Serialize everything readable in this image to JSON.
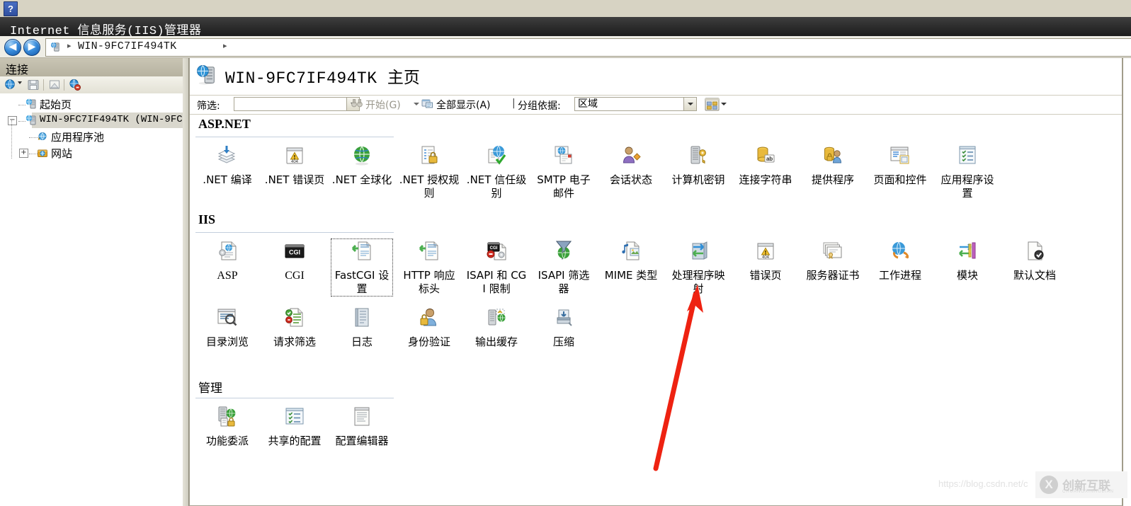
{
  "window": {
    "title": "Internet 信息服务(IIS)管理器",
    "help_icon": "?"
  },
  "address_bar": {
    "back_label": "◀",
    "forward_label": "▶",
    "server_icon": "server-icon",
    "breadcrumb": "WIN-9FC7IF494TK",
    "separator": "▸"
  },
  "connections": {
    "header": "连接",
    "toolbar": [
      "connect-to-icon",
      "save-icon",
      "export-icon",
      "disconnect-icon"
    ],
    "tree": [
      {
        "label": "起始页",
        "icon": "start-page-icon",
        "expander": "",
        "selected": false
      },
      {
        "label": "WIN-9FC7IF494TK (WIN-9FC",
        "icon": "server-icon",
        "expander": "−",
        "selected": true
      },
      {
        "label": "应用程序池",
        "icon": "app-pools-icon",
        "expander": "",
        "selected": false
      },
      {
        "label": "网站",
        "icon": "sites-icon",
        "expander": "+",
        "selected": false
      }
    ]
  },
  "page": {
    "icon": "server-home-icon",
    "title_server": "WIN-9FC7IF494TK",
    "title_suffix": "主页"
  },
  "filter_bar": {
    "filter_label": "筛选:",
    "filter_value": "",
    "filter_placeholder": "",
    "go_label": "开始(G)",
    "show_all_label": "全部显示(A)",
    "pipe": "|",
    "group_by_label": "分组依据:",
    "group_by_value": "区域",
    "view_icon": "views-icon"
  },
  "groups": [
    {
      "name": "ASP.NET",
      "latin_title": true,
      "items": [
        {
          "label": ".NET 编译",
          "icon": "net-compilation-icon"
        },
        {
          "label": ".NET 错误页",
          "icon": "net-error-pages-icon"
        },
        {
          "label": ".NET 全球化",
          "icon": "net-globalization-icon"
        },
        {
          "label": ".NET 授权规则",
          "icon": "net-authorization-icon"
        },
        {
          "label": ".NET 信任级别",
          "icon": "net-trust-levels-icon"
        },
        {
          "label": "SMTP 电子邮件",
          "icon": "smtp-email-icon"
        },
        {
          "label": "会话状态",
          "icon": "session-state-icon"
        },
        {
          "label": "计算机密钥",
          "icon": "machine-key-icon"
        },
        {
          "label": "连接字符串",
          "icon": "connection-strings-icon"
        },
        {
          "label": "提供程序",
          "icon": "providers-icon"
        },
        {
          "label": "页面和控件",
          "icon": "pages-and-controls-icon"
        },
        {
          "label": "应用程序设置",
          "icon": "application-settings-icon"
        }
      ]
    },
    {
      "name": "IIS",
      "latin_title": true,
      "items": [
        {
          "label": "ASP",
          "icon": "asp-icon"
        },
        {
          "label": "CGI",
          "icon": "cgi-icon"
        },
        {
          "label": "FastCGI 设置",
          "icon": "fastcgi-settings-icon",
          "focused": true
        },
        {
          "label": "HTTP 响应标头",
          "icon": "http-response-headers-icon"
        },
        {
          "label": "ISAPI 和 CGI 限制",
          "icon": "isapi-cgi-restrictions-icon"
        },
        {
          "label": "ISAPI 筛选器",
          "icon": "isapi-filters-icon"
        },
        {
          "label": "MIME 类型",
          "icon": "mime-types-icon"
        },
        {
          "label": "处理程序映射",
          "icon": "handler-mappings-icon"
        },
        {
          "label": "错误页",
          "icon": "error-pages-icon"
        },
        {
          "label": "服务器证书",
          "icon": "server-certificates-icon"
        },
        {
          "label": "工作进程",
          "icon": "worker-processes-icon"
        },
        {
          "label": "模块",
          "icon": "modules-icon"
        },
        {
          "label": "默认文档",
          "icon": "default-document-icon"
        },
        {
          "label": "目录浏览",
          "icon": "directory-browsing-icon"
        },
        {
          "label": "请求筛选",
          "icon": "request-filtering-icon"
        },
        {
          "label": "日志",
          "icon": "logging-icon"
        },
        {
          "label": "身份验证",
          "icon": "authentication-icon"
        },
        {
          "label": "输出缓存",
          "icon": "output-caching-icon"
        },
        {
          "label": "压缩",
          "icon": "compression-icon"
        }
      ]
    },
    {
      "name": "管理",
      "latin_title": false,
      "items": [
        {
          "label": "功能委派",
          "icon": "feature-delegation-icon"
        },
        {
          "label": "共享的配置",
          "icon": "shared-configuration-icon"
        },
        {
          "label": "配置编辑器",
          "icon": "configuration-editor-icon"
        }
      ]
    }
  ],
  "annotation": {
    "arrow_color": "#ee2211",
    "points_at": "处理程序映射"
  },
  "watermark": {
    "url": "https://blog.csdn.net/c",
    "logo_mark": "X",
    "logo_text": "创新互联",
    "logo_sub": "CHUANGXINHULIAN"
  }
}
